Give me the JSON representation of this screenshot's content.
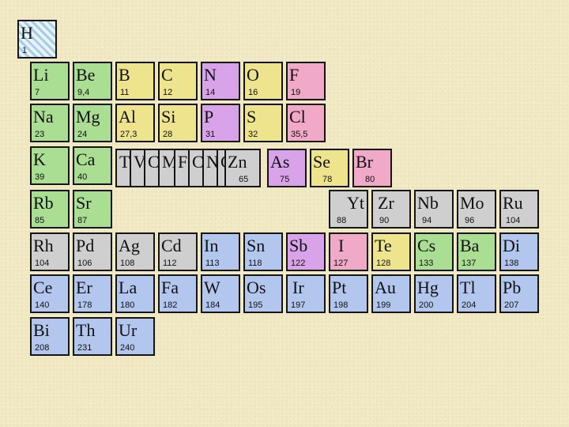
{
  "colors": {
    "background": "#f1e9c3",
    "green": "#a9de93",
    "yellow": "#efe48e",
    "violet": "#d8a3e8",
    "pink": "#f0a9c7",
    "blue": "#b3c7ee",
    "gray": "#cfcfcf",
    "sky": "#c9e2f3"
  },
  "elements": [
    {
      "symbol": "H",
      "mass": "1",
      "color": "sky",
      "pattern": "stripes"
    },
    {
      "symbol": "Li",
      "mass": "7",
      "color": "green"
    },
    {
      "symbol": "Be",
      "mass": "9,4",
      "color": "green"
    },
    {
      "symbol": "B",
      "mass": "11",
      "color": "yellow"
    },
    {
      "symbol": "C",
      "mass": "12",
      "color": "yellow"
    },
    {
      "symbol": "N",
      "mass": "14",
      "color": "violet"
    },
    {
      "symbol": "O",
      "mass": "16",
      "color": "yellow"
    },
    {
      "symbol": "F",
      "mass": "19",
      "color": "pink"
    },
    {
      "symbol": "Na",
      "mass": "23",
      "color": "green"
    },
    {
      "symbol": "Mg",
      "mass": "24",
      "color": "green"
    },
    {
      "symbol": "Al",
      "mass": "27,3",
      "color": "yellow"
    },
    {
      "symbol": "Si",
      "mass": "28",
      "color": "yellow"
    },
    {
      "symbol": "P",
      "mass": "31",
      "color": "violet"
    },
    {
      "symbol": "S",
      "mass": "32",
      "color": "yellow"
    },
    {
      "symbol": "Cl",
      "mass": "35,5",
      "color": "pink"
    },
    {
      "symbol": "K",
      "mass": "39",
      "color": "green"
    },
    {
      "symbol": "Ca",
      "mass": "40",
      "color": "green"
    },
    {
      "symbol": "Zn",
      "mass": "65",
      "color": "gray"
    },
    {
      "symbol": "As",
      "mass": "75",
      "color": "violet"
    },
    {
      "symbol": "Se",
      "mass": "78",
      "color": "yellow"
    },
    {
      "symbol": "Br",
      "mass": "80",
      "color": "pink"
    },
    {
      "symbol": "Rb",
      "mass": "85",
      "color": "green"
    },
    {
      "symbol": "Sr",
      "mass": "87",
      "color": "green"
    },
    {
      "symbol": "Yt",
      "mass": "88",
      "color": "gray"
    },
    {
      "symbol": "Zr",
      "mass": "90",
      "color": "gray"
    },
    {
      "symbol": "Nb",
      "mass": "94",
      "color": "gray"
    },
    {
      "symbol": "Mo",
      "mass": "96",
      "color": "gray"
    },
    {
      "symbol": "Ru",
      "mass": "104",
      "color": "gray"
    },
    {
      "symbol": "Rh",
      "mass": "104",
      "color": "gray"
    },
    {
      "symbol": "Pd",
      "mass": "106",
      "color": "gray"
    },
    {
      "symbol": "Ag",
      "mass": "108",
      "color": "gray"
    },
    {
      "symbol": "Cd",
      "mass": "112",
      "color": "gray"
    },
    {
      "symbol": "In",
      "mass": "113",
      "color": "blue"
    },
    {
      "symbol": "Sn",
      "mass": "118",
      "color": "blue"
    },
    {
      "symbol": "Sb",
      "mass": "122",
      "color": "violet"
    },
    {
      "symbol": "I",
      "mass": "127",
      "color": "pink"
    },
    {
      "symbol": "Te",
      "mass": "128",
      "color": "yellow"
    },
    {
      "symbol": "Cs",
      "mass": "133",
      "color": "green"
    },
    {
      "symbol": "Ba",
      "mass": "137",
      "color": "green"
    },
    {
      "symbol": "Di",
      "mass": "138",
      "color": "blue"
    },
    {
      "symbol": "Ce",
      "mass": "140",
      "color": "blue"
    },
    {
      "symbol": "Er",
      "mass": "178",
      "color": "blue"
    },
    {
      "symbol": "La",
      "mass": "180",
      "color": "blue"
    },
    {
      "symbol": "Fa",
      "mass": "182",
      "color": "blue"
    },
    {
      "symbol": "W",
      "mass": "184",
      "color": "blue"
    },
    {
      "symbol": "Os",
      "mass": "195",
      "color": "blue"
    },
    {
      "symbol": "Ir",
      "mass": "197",
      "color": "blue"
    },
    {
      "symbol": "Pt",
      "mass": "198",
      "color": "blue"
    },
    {
      "symbol": "Au",
      "mass": "199",
      "color": "blue"
    },
    {
      "symbol": "Hg",
      "mass": "200",
      "color": "blue"
    },
    {
      "symbol": "Tl",
      "mass": "204",
      "color": "blue"
    },
    {
      "symbol": "Pb",
      "mass": "207",
      "color": "blue"
    },
    {
      "symbol": "Bi",
      "mass": "208",
      "color": "blue"
    },
    {
      "symbol": "Th",
      "mass": "231",
      "color": "blue"
    },
    {
      "symbol": "Ur",
      "mass": "240",
      "color": "blue"
    }
  ],
  "stacked_cells": [
    {
      "symbol": "T",
      "color": "gray"
    },
    {
      "symbol": "V",
      "color": "gray"
    },
    {
      "symbol": "C",
      "color": "gray"
    },
    {
      "symbol": "M",
      "color": "gray"
    },
    {
      "symbol": "F",
      "color": "gray"
    },
    {
      "symbol": "C",
      "color": "gray"
    },
    {
      "symbol": "N",
      "color": "gray"
    },
    {
      "symbol": "C",
      "color": "gray"
    }
  ]
}
